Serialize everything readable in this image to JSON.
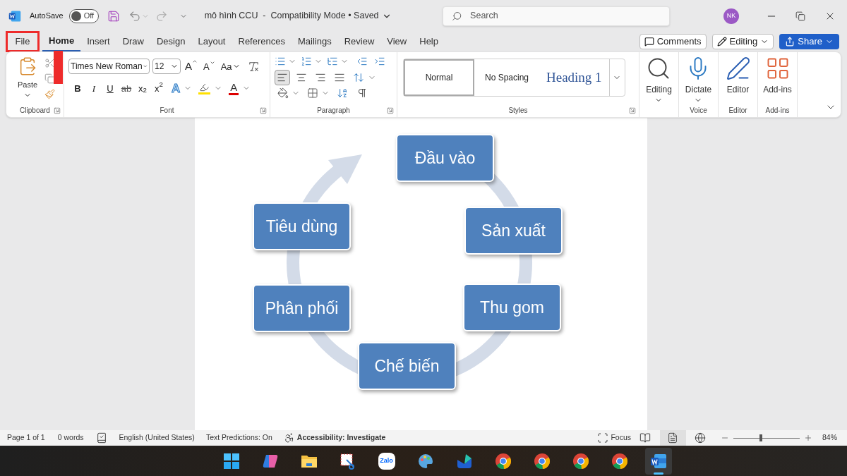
{
  "title_bar": {
    "autosave_label": "AutoSave",
    "autosave": {
      "on": false,
      "label": "Off"
    },
    "document_title": "mô hình CCU  -  Compatibility Mode • Saved",
    "search": {
      "placeholder": "Search"
    },
    "avatar": "NK"
  },
  "tabs": [
    {
      "label": "File",
      "selected": false,
      "highlighted": true
    },
    {
      "label": "Home",
      "selected": true,
      "highlighted": false
    },
    {
      "label": "Insert",
      "selected": false,
      "highlighted": false
    },
    {
      "label": "Draw",
      "selected": false,
      "highlighted": false
    },
    {
      "label": "Design",
      "selected": false,
      "highlighted": false
    },
    {
      "label": "Layout",
      "selected": false,
      "highlighted": false
    },
    {
      "label": "References",
      "selected": false,
      "highlighted": false
    },
    {
      "label": "Mailings",
      "selected": false,
      "highlighted": false
    },
    {
      "label": "Review",
      "selected": false,
      "highlighted": false
    },
    {
      "label": "View",
      "selected": false,
      "highlighted": false
    },
    {
      "label": "Help",
      "selected": false,
      "highlighted": false
    }
  ],
  "actions": [
    {
      "label": "Comments",
      "kind": "comments"
    },
    {
      "label": "Editing",
      "kind": "mode"
    },
    {
      "label": "Share",
      "kind": "share"
    }
  ],
  "ribbon": {
    "clipboard": {
      "paste": "Paste",
      "group": "Clipboard"
    },
    "font": {
      "name": "Times New Roman",
      "size": "12",
      "grow": "A",
      "shrink": "A",
      "change_case": "Aa",
      "group": "Font",
      "format_buttons": [
        {
          "label": "B",
          "kind": "bold"
        },
        {
          "label": "I",
          "kind": "italic"
        },
        {
          "label": "U",
          "kind": "underline"
        },
        {
          "label": "ab",
          "kind": "strike"
        },
        {
          "label": "x$_{2}$",
          "kind": "plain"
        },
        {
          "label": "x$^{2}$",
          "kind": "plain"
        }
      ],
      "text_effects": "A",
      "font_color": "A"
    },
    "paragraph": {
      "group": "Paragraph",
      "alignment": [
        {
          "kind": "left",
          "selected": true
        },
        {
          "kind": "center",
          "selected": false
        },
        {
          "kind": "right",
          "selected": false
        },
        {
          "kind": "justify",
          "selected": false
        }
      ]
    },
    "styles": {
      "group": "Styles",
      "items": [
        {
          "label": "Normal",
          "kind": "body",
          "selected": true
        },
        {
          "label": "No Spacing",
          "kind": "body",
          "selected": false
        },
        {
          "label": "Heading 1",
          "kind": "heading",
          "selected": false
        }
      ]
    },
    "big_buttons": [
      {
        "label": "Editing",
        "kind": "find"
      },
      {
        "label": "Dictate",
        "kind": "mic",
        "group": "Voice"
      },
      {
        "label": "Editor",
        "kind": "editor",
        "group": "Editor"
      },
      {
        "label": "Add-ins",
        "kind": "addins",
        "group": "Add-ins"
      }
    ]
  },
  "diagram": {
    "nodes": [
      "Đầu vào",
      "Sản xuất",
      "Thu gom",
      "Chế biến",
      "Phân phối",
      "Tiêu dùng"
    ]
  },
  "status_bar": {
    "page": "Page 1 of 1",
    "words": "0 words",
    "language": "English (United States)",
    "predictions": "Text Predictions: On",
    "accessibility": "Accessibility: Investigate",
    "focus": "Focus",
    "views": [
      {
        "kind": "read",
        "selected": false
      },
      {
        "kind": "print",
        "selected": true
      },
      {
        "kind": "web",
        "selected": false
      }
    ],
    "zoom": {
      "level": 0.41
    },
    "zoom_label": "84%"
  },
  "taskbar": {
    "apps": [
      {
        "kind": "start",
        "selected": false
      },
      {
        "kind": "copilot",
        "selected": false
      },
      {
        "kind": "files",
        "selected": false
      },
      {
        "kind": "snip",
        "selected": false
      },
      {
        "kind": "zalo",
        "label": "Zalo",
        "selected": false
      },
      {
        "kind": "paint",
        "selected": false
      },
      {
        "kind": "mail",
        "selected": false
      },
      {
        "kind": "chrome",
        "selected": false
      },
      {
        "kind": "chrome",
        "selected": false
      },
      {
        "kind": "chrome",
        "selected": false
      },
      {
        "kind": "chrome",
        "selected": false
      },
      {
        "kind": "word",
        "selected": true
      }
    ]
  }
}
